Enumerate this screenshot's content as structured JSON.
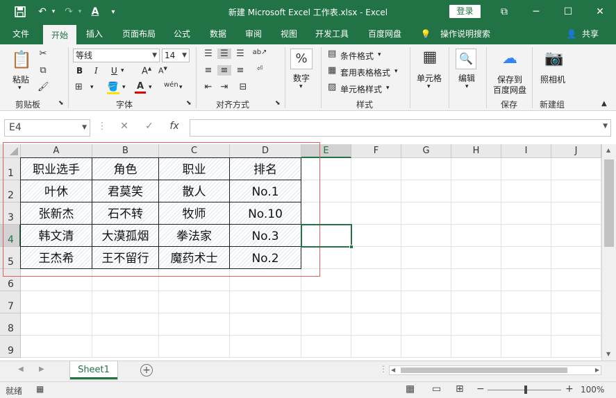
{
  "window": {
    "title": "新建 Microsoft Excel 工作表.xlsx  -  Excel",
    "login_label": "登录",
    "save_icon": "save-icon",
    "undo_icon": "undo-icon",
    "redo_icon": "redo-icon",
    "font_color_icon": "font-color-icon"
  },
  "ribbon_tabs": [
    "文件",
    "开始",
    "插入",
    "页面布局",
    "公式",
    "数据",
    "审阅",
    "视图",
    "开发工具",
    "百度网盘",
    "操作说明搜索"
  ],
  "active_tab": "开始",
  "share_label": "共享",
  "ribbon": {
    "paste_label": "粘贴",
    "clipboard_label": "剪贴板",
    "font_name": "等线",
    "font_size": "14",
    "bold": "B",
    "italic": "I",
    "underline": "U",
    "font_group_label": "字体",
    "align_group_label": "对齐方式",
    "number_label": "数字",
    "number_symbol": "%",
    "cond_format": "条件格式",
    "table_format": "套用表格格式",
    "cell_style": "单元格样式",
    "style_group_label": "样式",
    "cells_label": "单元格",
    "edit_label": "编辑",
    "save_baidu_line1": "保存到",
    "save_baidu_line2": "百度网盘",
    "save_group_label": "保存",
    "camera_label": "照相机",
    "new_group_label": "新建组"
  },
  "formula_bar": {
    "name_box": "E4",
    "formula": ""
  },
  "columns": [
    "A",
    "B",
    "C",
    "D",
    "E",
    "F",
    "G",
    "H",
    "I",
    "J"
  ],
  "rows": [
    "1",
    "2",
    "3",
    "4",
    "5",
    "6",
    "7",
    "8",
    "9"
  ],
  "table": [
    [
      "职业选手",
      "角色",
      "职业",
      "排名"
    ],
    [
      "叶休",
      "君莫笑",
      "散人",
      "No.1"
    ],
    [
      "张新杰",
      "石不转",
      "牧师",
      "No.10"
    ],
    [
      "韩文清",
      "大漠孤烟",
      "拳法家",
      "No.3"
    ],
    [
      "王杰希",
      "王不留行",
      "魔药术士",
      "No.2"
    ]
  ],
  "sheet_tab": "Sheet1",
  "status": {
    "ready": "就绪",
    "zoom": "100%"
  },
  "accent_color": "#217346",
  "selection_border_color": "#e06060"
}
